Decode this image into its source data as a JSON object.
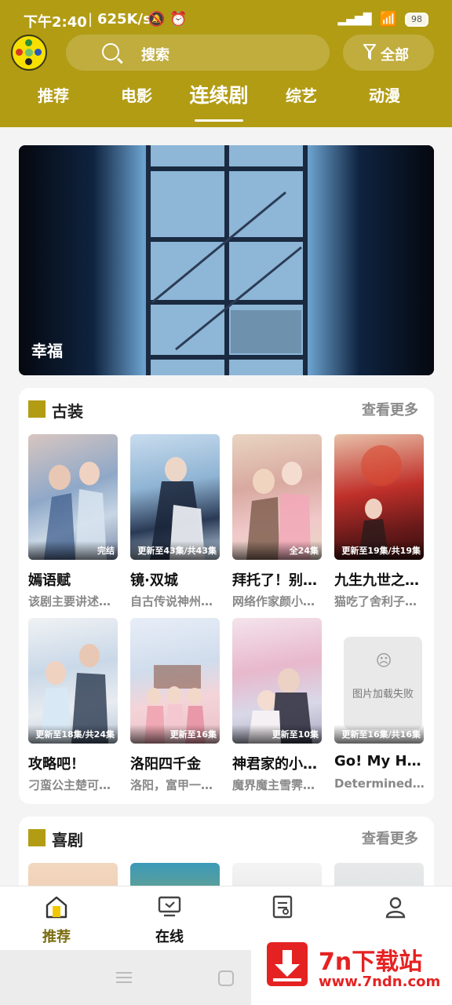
{
  "status_bar": {
    "time": "下午2:40",
    "separator": "|",
    "speed": "625K/s",
    "battery": "98",
    "icons": [
      "mute-icon",
      "alarm-icon",
      "hd-signal-icon",
      "wifi-icon",
      "battery-icon"
    ]
  },
  "header": {
    "search_label": "搜索",
    "filter_label": "全部",
    "tabs": [
      {
        "label": "推荐"
      },
      {
        "label": "电影"
      },
      {
        "label": "连续剧"
      },
      {
        "label": "综艺"
      },
      {
        "label": "动漫"
      }
    ],
    "active_tab": "连续剧"
  },
  "banner": {
    "label": "幸福"
  },
  "sections": [
    {
      "title": "古装",
      "more": "查看更多",
      "items": [
        {
          "title": "嫣语赋",
          "desc": "该剧主要讲述了…",
          "badge": "完结"
        },
        {
          "title": "镜·双城",
          "desc": "自古传说神州大…",
          "badge": "更新至43集/共43集"
        },
        {
          "title": "拜托了！别宠我",
          "desc": "网络作家颜小朵…",
          "badge": "全24集"
        },
        {
          "title": "九生九世之落魄",
          "desc": "猫吃了舍利子，…",
          "badge": "更新至19集/共19集"
        },
        {
          "title": "攻略吧！",
          "desc": "刁蛮公主楚可可…",
          "badge": "更新至18集/共24集"
        },
        {
          "title": "洛阳四千金",
          "desc": "洛阳，富甲一方…",
          "badge": "更新至16集"
        },
        {
          "title": "神君家的小狐狸",
          "desc": "魔界魔主雪霁…",
          "badge": "更新至10集"
        },
        {
          "title": "Go! My Heart",
          "desc": "Determined to…",
          "badge": "更新至16集/共16集",
          "image_failed": true,
          "image_failed_text": "图片加载失败"
        }
      ]
    },
    {
      "title": "喜剧",
      "more": "查看更多"
    }
  ],
  "bottom_nav": [
    {
      "label": "推荐",
      "icon": "home-icon",
      "active": true
    },
    {
      "label": "在线",
      "icon": "tv-icon"
    },
    {
      "label": "",
      "icon": "list-icon"
    },
    {
      "label": "",
      "icon": "user-icon"
    }
  ],
  "watermark": {
    "title": "7n下载站",
    "url": "www.7ndn.com"
  },
  "colors": {
    "header": "#b29c14",
    "accent": "#b29c14",
    "watermark": "#e52222"
  }
}
